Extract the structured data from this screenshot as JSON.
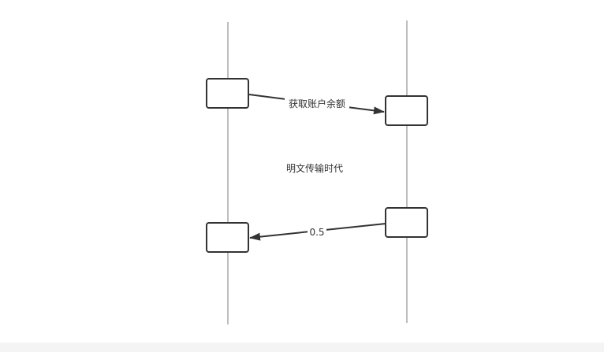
{
  "diagram": {
    "messages": [
      {
        "label": "获取账户余额"
      },
      {
        "label": "0.5"
      }
    ],
    "note": "明文传输时代"
  },
  "colors": {
    "lifeline": "#bdbdbd",
    "stroke": "#333333",
    "text": "#333333",
    "background": "#ffffff",
    "bottom_band": "#f4f4f4"
  }
}
